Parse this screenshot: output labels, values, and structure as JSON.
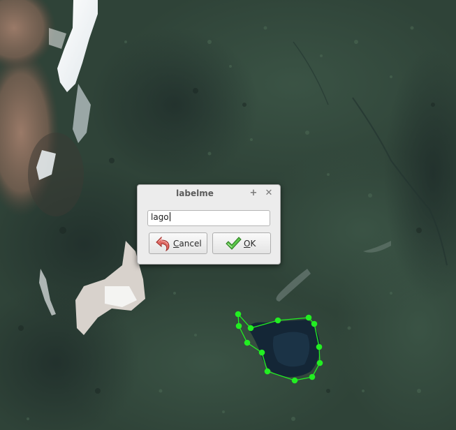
{
  "app": {
    "window_title": "labelme"
  },
  "dialog": {
    "title": "labelme",
    "label_input": {
      "value": "lago",
      "placeholder": ""
    },
    "cancel_button": {
      "mnemonic": "C",
      "rest": "ancel",
      "icon": "undo-arrow-icon"
    },
    "ok_button": {
      "mnemonic": "O",
      "rest": "K",
      "icon": "checkmark-icon"
    },
    "titlebar_buttons": {
      "maximize_glyph": "+",
      "close_glyph": "✕"
    }
  },
  "annotation": {
    "vertex_count": 13,
    "color": "#22ee22"
  },
  "colors": {
    "dialog_bg": "#ececec",
    "accent_green": "#22ee22",
    "cancel_arrow": "#d9534f",
    "ok_check": "#3cae2a"
  }
}
